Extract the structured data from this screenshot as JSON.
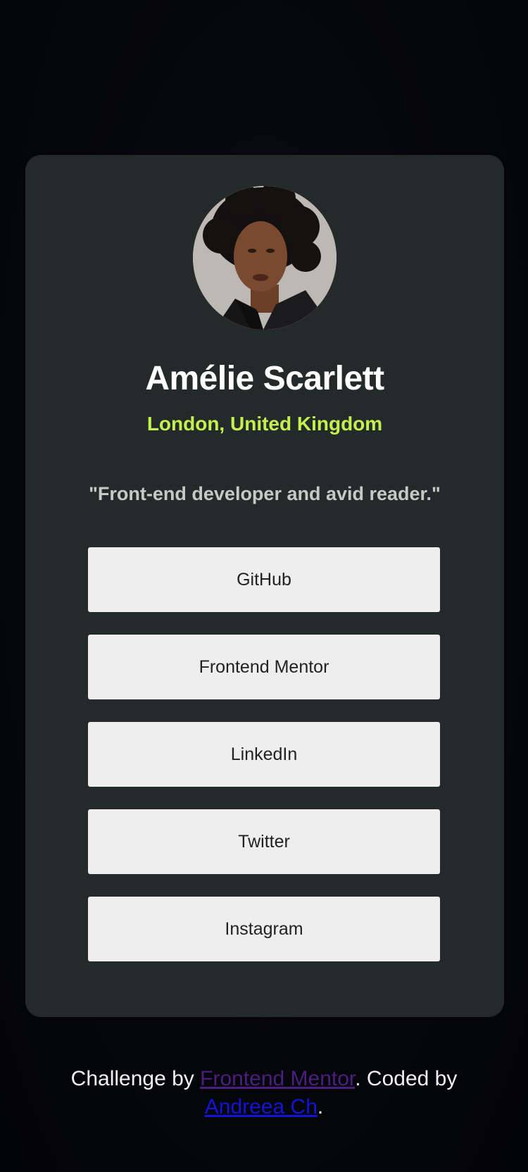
{
  "profile": {
    "name": "Amélie Scarlett",
    "location": "London, United Kingdom",
    "bio": "\"Front-end developer and avid reader.\""
  },
  "links": [
    {
      "label": "GitHub"
    },
    {
      "label": "Frontend Mentor"
    },
    {
      "label": "LinkedIn"
    },
    {
      "label": "Twitter"
    },
    {
      "label": "Instagram"
    }
  ],
  "footer": {
    "prefix": "Challenge by ",
    "challenge_link": "Frontend Mentor",
    "middle": ". Coded by ",
    "author_link": "Andreea Ch",
    "suffix": "."
  },
  "colors": {
    "background": "#05060a",
    "card": "#232a29",
    "accent": "#c4f04f",
    "button": "#eeeeee"
  }
}
